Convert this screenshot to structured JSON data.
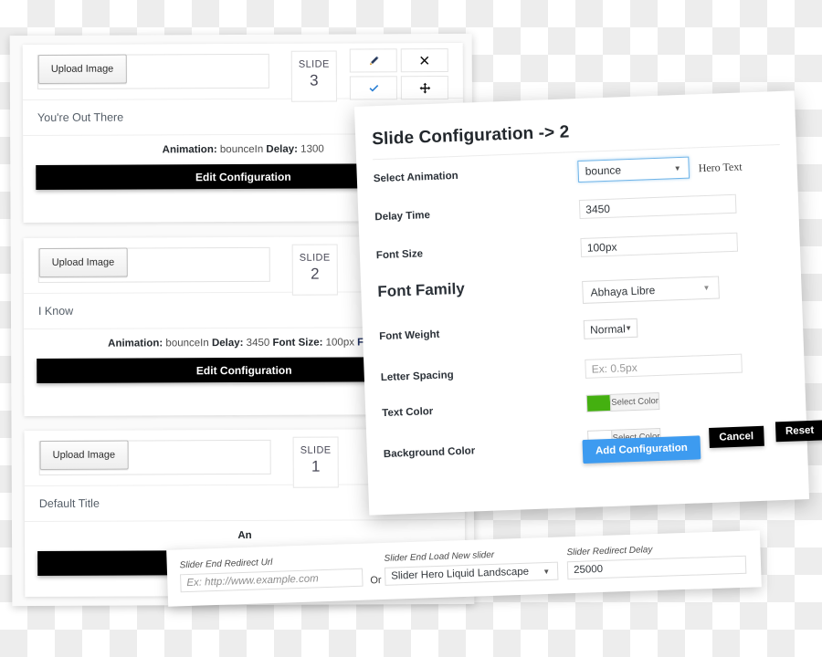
{
  "slides_card": {
    "slides": [
      {
        "upload_label": "Upload Image",
        "badge_word": "SLIDE",
        "badge_num": "3",
        "title": "You're Out There",
        "meta_prefix": "Animation:",
        "meta_anim": "bounceIn",
        "meta_delay_label": "Delay:",
        "meta_delay": "1300",
        "meta_fontsize_label": "",
        "meta_fontsize": "",
        "meta_tail": "",
        "edit_label": "Edit Configuration",
        "icons": [
          {
            "name": "edit-pencil-icon",
            "glyph": "pencil"
          },
          {
            "name": "close-x-icon",
            "glyph": "x"
          },
          {
            "name": "checkmark-icon",
            "glyph": "check"
          },
          {
            "name": "move-arrows-icon",
            "glyph": "move"
          }
        ]
      },
      {
        "upload_label": "Upload Image",
        "badge_word": "SLIDE",
        "badge_num": "2",
        "title": "I Know",
        "meta_prefix": "Animation:",
        "meta_anim": "bounceIn",
        "meta_delay_label": "Delay:",
        "meta_delay": "3450",
        "meta_fontsize_label": "Font Size:",
        "meta_fontsize": "100px",
        "meta_tail": "Font",
        "edit_label": "Edit Configuration",
        "icons": []
      },
      {
        "upload_label": "Upload Image",
        "badge_word": "SLIDE",
        "badge_num": "1",
        "title": "Default Title",
        "meta_prefix": "An",
        "meta_anim": "",
        "meta_delay_label": "",
        "meta_delay": "",
        "meta_fontsize_label": "",
        "meta_fontsize": "",
        "meta_tail": "",
        "edit_label": "",
        "icons": []
      }
    ]
  },
  "modal": {
    "title": "Slide Configuration -> 2",
    "fields": {
      "select_animation_label": "Select Animation",
      "select_animation_value": "bounce",
      "hero_text": "Hero Text",
      "delay_time_label": "Delay Time",
      "delay_time_value": "3450",
      "font_size_label": "Font Size",
      "font_size_value": "100px",
      "font_family_label": "Font Family",
      "font_family_value": "Abhaya Libre",
      "font_weight_label": "Font Weight",
      "font_weight_value": "Normal",
      "letter_spacing_label": "Letter Spacing",
      "letter_spacing_placeholder": "Ex: 0.5px",
      "text_color_label": "Text Color",
      "text_color_button": "Select Color",
      "text_color_value": "#44b010",
      "background_color_label": "Background Color",
      "background_color_button": "Select Color",
      "background_color_value": "#ffffff"
    },
    "buttons": {
      "add": "Add Configuration",
      "cancel": "Cancel",
      "reset": "Reset",
      "add_color": "#3d9bf0"
    }
  },
  "bottom_panel": {
    "redirect_url_label": "Slider End Redirect Url",
    "redirect_url_placeholder": "Ex: http://www.example.com",
    "or_text": "Or",
    "load_new_slider_label": "Slider End Load New slider",
    "load_new_slider_value": "Slider Hero Liquid Landscape",
    "redirect_delay_label": "Slider Redirect Delay",
    "redirect_delay_value": "25000"
  }
}
